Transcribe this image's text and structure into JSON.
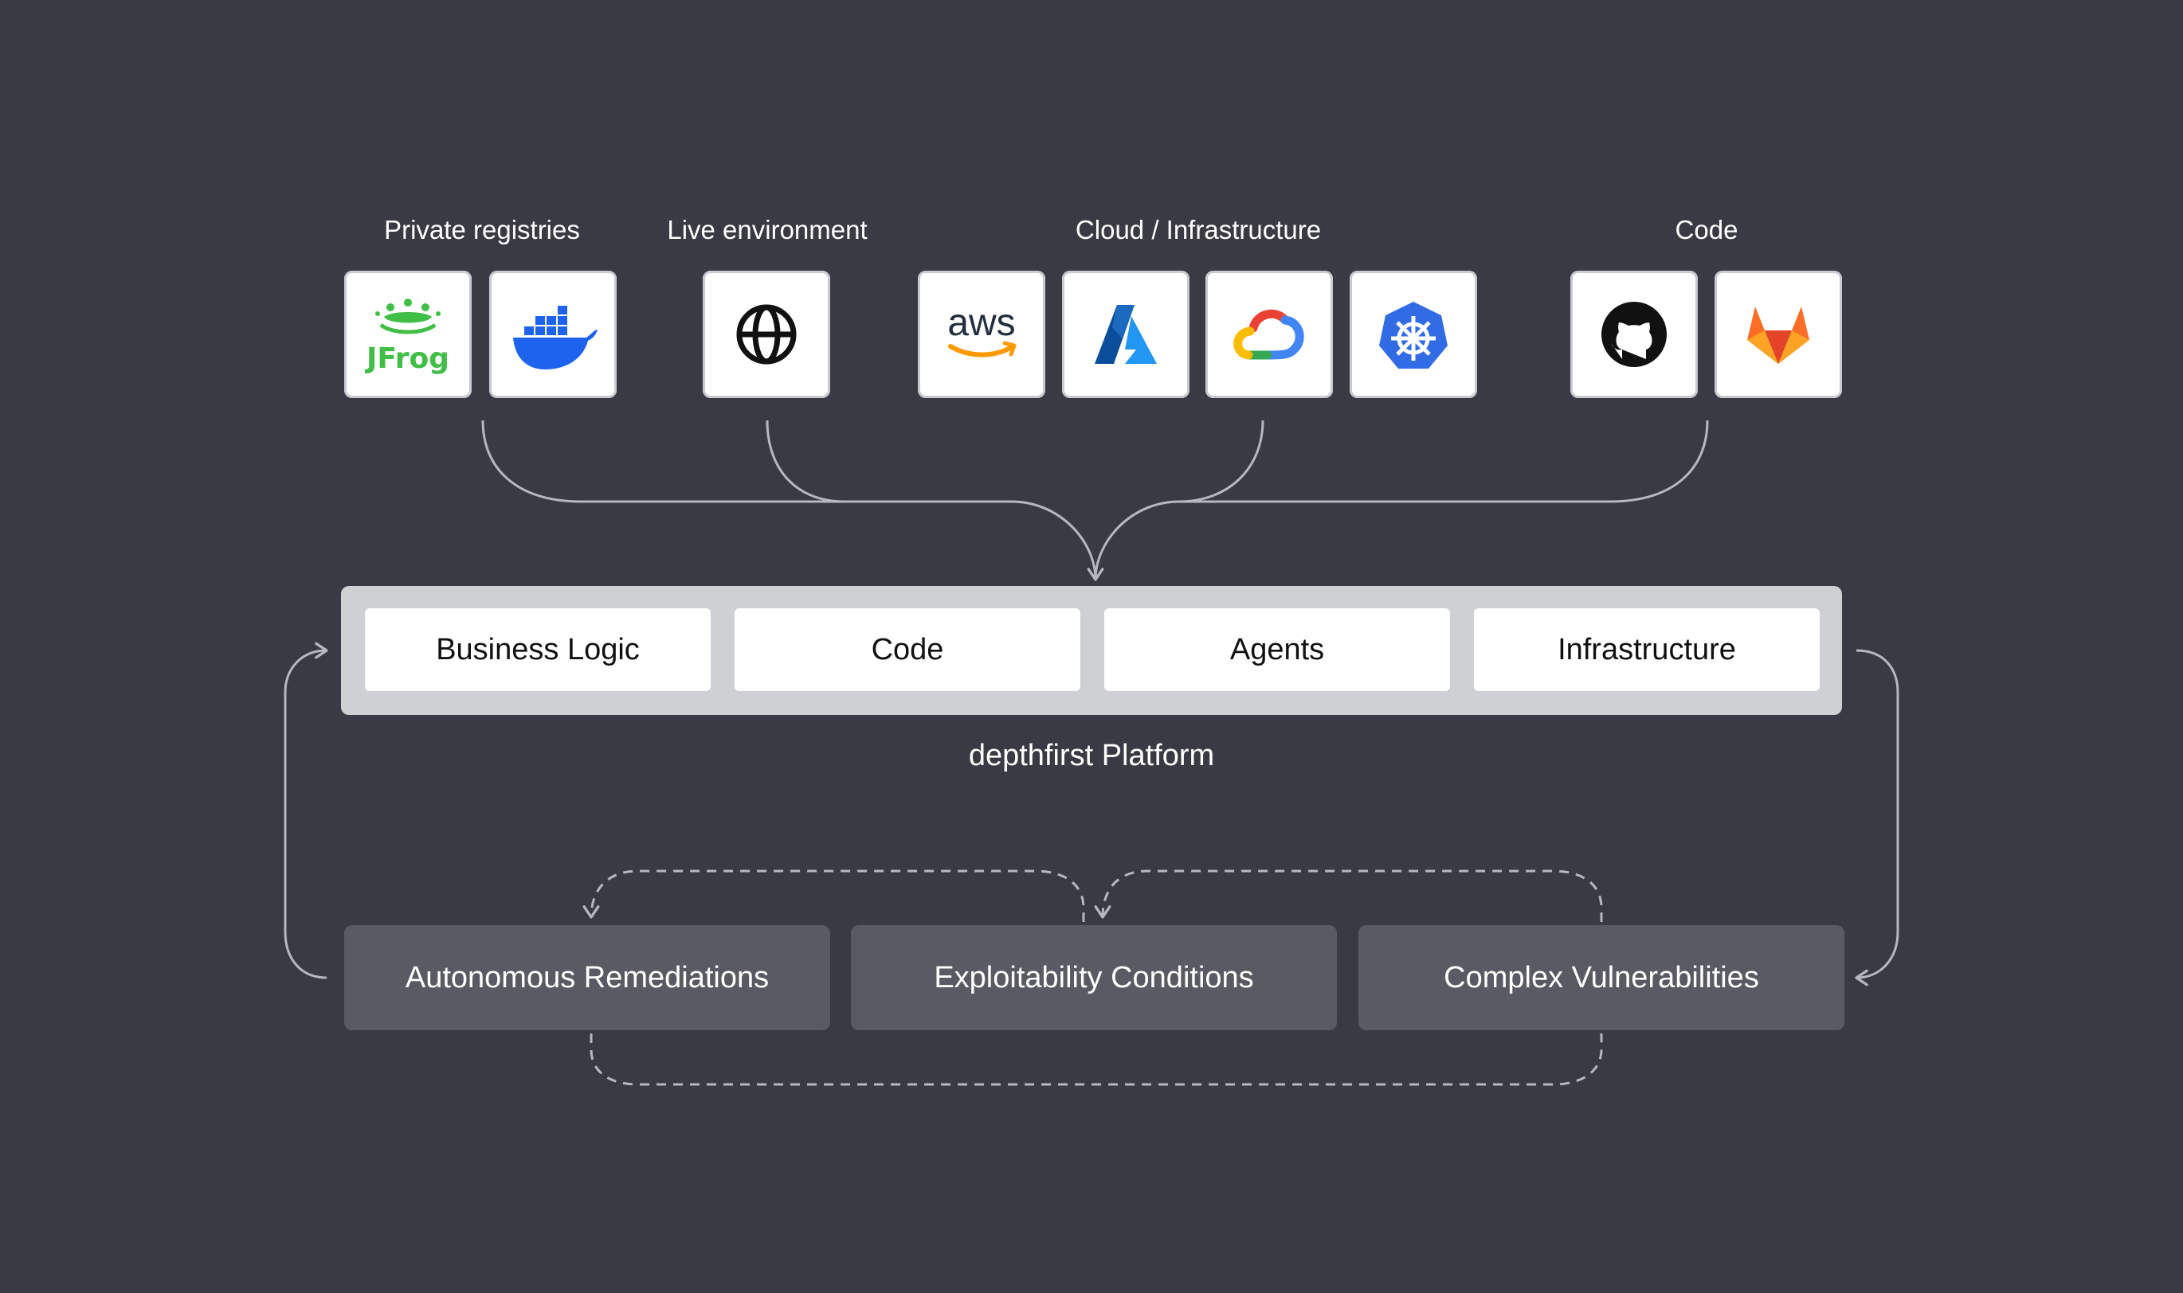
{
  "groups": [
    {
      "label": "Private registries",
      "tiles": [
        {
          "icon": "jfrog-logo",
          "text": "JFrog"
        },
        {
          "icon": "docker-logo"
        }
      ]
    },
    {
      "label": "Live environment",
      "tiles": [
        {
          "icon": "globe-icon"
        }
      ]
    },
    {
      "label": "Cloud / Infrastructure",
      "tiles": [
        {
          "icon": "aws-logo",
          "text": "aws"
        },
        {
          "icon": "azure-logo"
        },
        {
          "icon": "google-cloud-logo"
        },
        {
          "icon": "kubernetes-logo"
        }
      ]
    },
    {
      "label": "Code",
      "tiles": [
        {
          "icon": "github-logo"
        },
        {
          "icon": "gitlab-logo"
        }
      ]
    }
  ],
  "platform": {
    "name": "depthfirst Platform",
    "layers": [
      "Business Logic",
      "Code",
      "Agents",
      "Infrastructure"
    ]
  },
  "stages": [
    "Autonomous Remediations",
    "Exploitability Conditions",
    "Complex Vulnerabilities"
  ],
  "colors": {
    "background": "#3a3a44",
    "platform_frame": "#cfd0d4",
    "stage_fill": "#595a63",
    "connector": "#b7b8be",
    "jfrog": "#40be46",
    "docker": "#1d63ed",
    "aws_orange": "#ff9900",
    "azure": "#0a73c8",
    "kubernetes": "#326ce5",
    "gitlab": "#fc6d26"
  }
}
